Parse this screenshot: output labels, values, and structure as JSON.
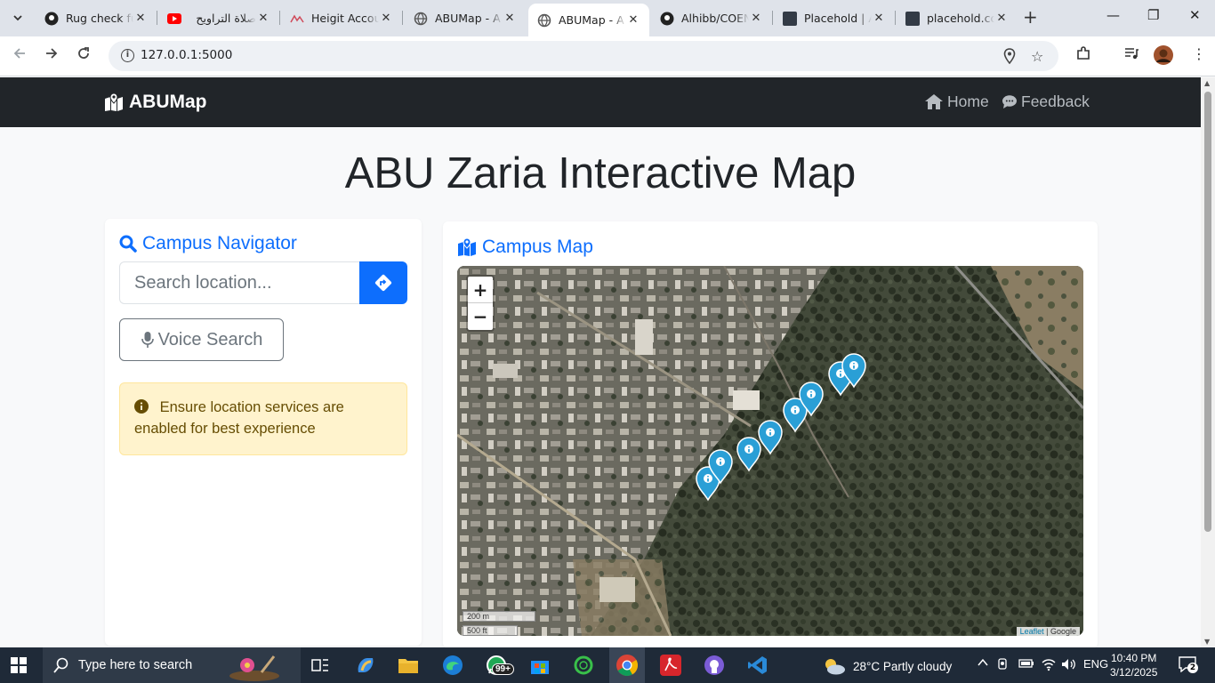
{
  "browser": {
    "tabs": [
      {
        "title": "Rug check fu",
        "icon": "github-icon",
        "active": false
      },
      {
        "title": "صلاة التراويح",
        "icon": "youtube-icon",
        "active": false
      },
      {
        "title": "Heigit Accou",
        "icon": "heigit-icon",
        "active": false
      },
      {
        "title": "ABUMap - A",
        "icon": "globe-icon",
        "active": false
      },
      {
        "title": "ABUMap - A",
        "icon": "globe-icon",
        "active": true
      },
      {
        "title": "Alhibb/COEN",
        "icon": "github-icon",
        "active": false
      },
      {
        "title": "Placehold | A",
        "icon": "placehold-icon",
        "active": false
      },
      {
        "title": "placehold.co",
        "icon": "placehold-icon",
        "active": false
      }
    ],
    "url": "127.0.0.1:5000"
  },
  "navbar": {
    "brand": "ABUMap",
    "links": [
      {
        "label": "Home",
        "icon": "home-icon"
      },
      {
        "label": "Feedback",
        "icon": "comment-icon"
      }
    ]
  },
  "page": {
    "title": "ABU Zaria Interactive Map"
  },
  "navigator": {
    "title": "Campus Navigator",
    "search_placeholder": "Search location...",
    "voice_label": "Voice Search",
    "alert": "Ensure location services are enabled for best experience"
  },
  "map_card": {
    "title": "Campus Map",
    "zoom_in": "+",
    "zoom_out": "−",
    "scale_metric": "200 m",
    "scale_imperial": "500 ft",
    "attribution_link": "Leaflet",
    "attribution_sep": " | ",
    "attribution_source": "Google",
    "marker_count": 8,
    "marker_color": "#2a9fd6"
  },
  "taskbar": {
    "search_placeholder": "Type here to search",
    "whatsapp_badge": "99+",
    "weather": "28°C  Partly cloudy",
    "language": "ENG",
    "time": "10:40 PM",
    "date": "3/12/2025",
    "notifications": "2"
  },
  "colors": {
    "primary": "#0d6efd",
    "navbar_bg": "#212529",
    "alert_bg": "#fff3cd",
    "alert_text": "#664d03"
  }
}
